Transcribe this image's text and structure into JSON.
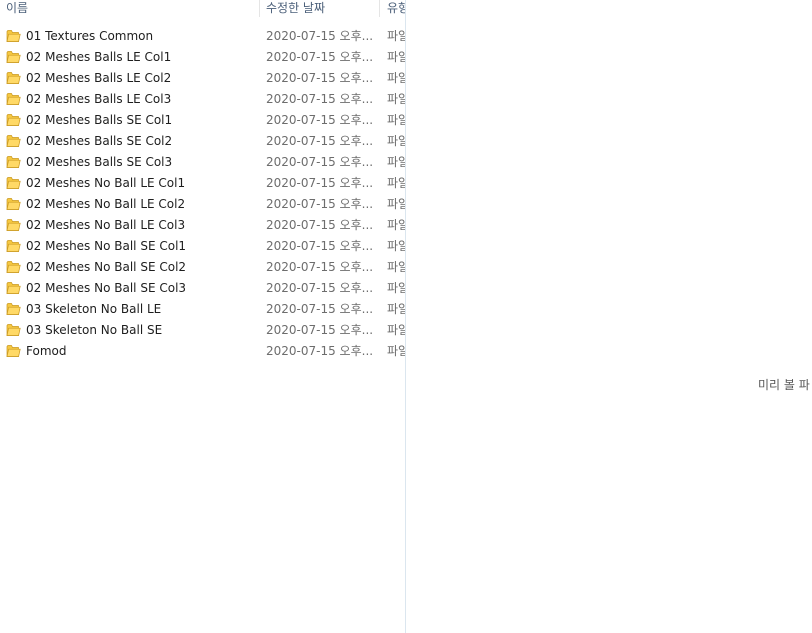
{
  "columns": {
    "name": "이름",
    "date": "수정한 날짜",
    "type": "유형"
  },
  "items": [
    {
      "name": "01 Textures Common",
      "date": "2020-07-15 오후...",
      "type": "파일"
    },
    {
      "name": "02 Meshes Balls LE Col1",
      "date": "2020-07-15 오후...",
      "type": "파일"
    },
    {
      "name": "02 Meshes Balls LE Col2",
      "date": "2020-07-15 오후...",
      "type": "파일"
    },
    {
      "name": "02 Meshes Balls LE Col3",
      "date": "2020-07-15 오후...",
      "type": "파일"
    },
    {
      "name": "02 Meshes Balls SE Col1",
      "date": "2020-07-15 오후...",
      "type": "파일"
    },
    {
      "name": "02 Meshes Balls SE Col2",
      "date": "2020-07-15 오후...",
      "type": "파일"
    },
    {
      "name": "02 Meshes Balls SE Col3",
      "date": "2020-07-15 오후...",
      "type": "파일"
    },
    {
      "name": "02 Meshes No Ball LE Col1",
      "date": "2020-07-15 오후...",
      "type": "파일"
    },
    {
      "name": "02 Meshes No Ball LE Col2",
      "date": "2020-07-15 오후...",
      "type": "파일"
    },
    {
      "name": "02 Meshes No Ball LE Col3",
      "date": "2020-07-15 오후...",
      "type": "파일"
    },
    {
      "name": "02 Meshes No Ball SE Col1",
      "date": "2020-07-15 오후...",
      "type": "파일"
    },
    {
      "name": "02 Meshes No Ball SE Col2",
      "date": "2020-07-15 오후...",
      "type": "파일"
    },
    {
      "name": "02 Meshes No Ball SE Col3",
      "date": "2020-07-15 오후...",
      "type": "파일"
    },
    {
      "name": "03 Skeleton No Ball LE",
      "date": "2020-07-15 오후...",
      "type": "파일"
    },
    {
      "name": "03 Skeleton No Ball SE",
      "date": "2020-07-15 오후...",
      "type": "파일"
    },
    {
      "name": "Fomod",
      "date": "2020-07-15 오후...",
      "type": "파일"
    }
  ],
  "preview": {
    "message": "미리 볼 파"
  },
  "icons": {
    "folder": "folder-icon"
  },
  "colors": {
    "folder_body": "#f5c842",
    "folder_front": "#ffd966",
    "folder_edge": "#c9981f",
    "header_text": "#4c607a",
    "pane_divider": "#dbe6ef"
  }
}
